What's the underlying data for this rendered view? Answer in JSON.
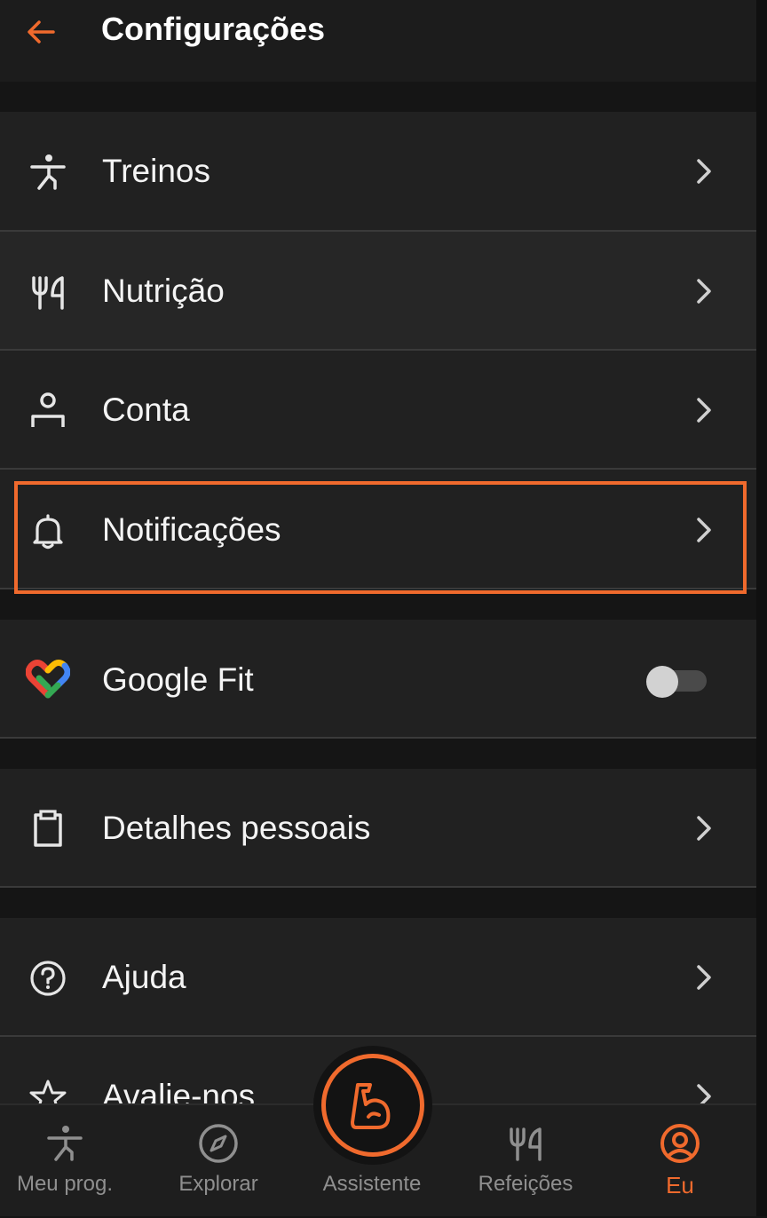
{
  "header": {
    "title": "Configurações"
  },
  "menu": {
    "items": [
      {
        "label": "Treinos",
        "icon": "exercise-figure-icon"
      },
      {
        "label": "Nutrição",
        "icon": "fork-knife-icon"
      },
      {
        "label": "Conta",
        "icon": "person-icon"
      },
      {
        "label": "Notificações",
        "icon": "bell-icon"
      }
    ],
    "google_fit": {
      "label": "Google Fit",
      "enabled": false,
      "icon": "google-fit-heart-icon"
    },
    "personal": {
      "label": "Detalhes pessoais",
      "icon": "clipboard-icon"
    },
    "help": [
      {
        "label": "Ajuda",
        "icon": "help-circle-icon"
      },
      {
        "label": "Avalie-nos",
        "icon": "star-icon"
      }
    ]
  },
  "nav": {
    "items": [
      {
        "label": "Meu prog.",
        "icon": "exercise-figure-icon"
      },
      {
        "label": "Explorar",
        "icon": "compass-icon"
      },
      {
        "label": "Assistente",
        "icon": "muscle-arm-icon"
      },
      {
        "label": "Refeições",
        "icon": "fork-knife-icon"
      },
      {
        "label": "Eu",
        "icon": "user-circle-icon"
      }
    ],
    "active": "Eu"
  },
  "colors": {
    "accent": "#f06a2d",
    "background": "#151515",
    "row": "#212121",
    "text": "#f4f4f4",
    "muted": "#8f8f8f"
  }
}
